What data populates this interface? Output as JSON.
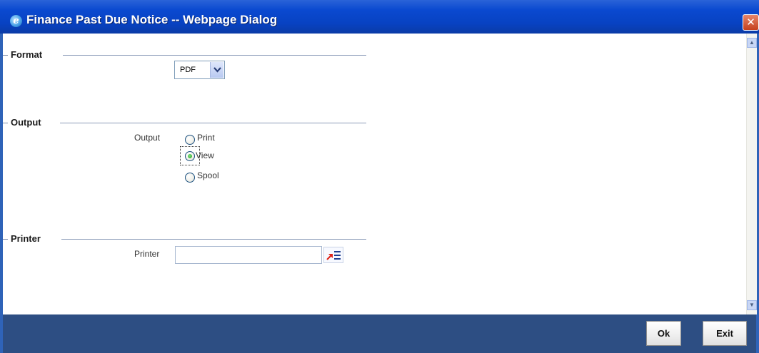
{
  "window": {
    "title": "Finance Past Due Notice -- Webpage Dialog",
    "close_symbol": "✕",
    "icon": "ie-icon",
    "colors": {
      "titlebar": "#0842c2",
      "footer": "#2d4e83",
      "frame": "#2f63b8"
    }
  },
  "format_section": {
    "legend": "Format",
    "select_value": "PDF"
  },
  "output_section": {
    "legend": "Output",
    "field_label": "Output",
    "options": [
      {
        "label": "Print",
        "checked": false
      },
      {
        "label": "View",
        "checked": true
      },
      {
        "label": "Spool",
        "checked": false
      }
    ]
  },
  "printer_section": {
    "legend": "Printer",
    "field_label": "Printer",
    "input_value": "",
    "lov_icon": "list-of-values-icon"
  },
  "footer": {
    "ok_label": "Ok",
    "exit_label": "Exit"
  },
  "scrollbar": {
    "up_symbol": "▲",
    "down_symbol": "▼"
  }
}
